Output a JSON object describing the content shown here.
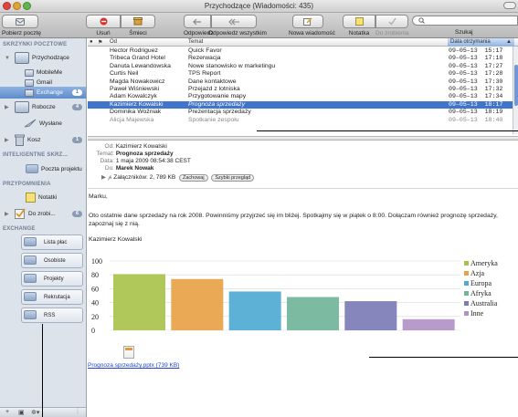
{
  "window": {
    "title": "Przychodzące (Wiadomości: 435)"
  },
  "toolbar": {
    "get_mail": "Pobierz pocztę",
    "delete": "Usuń",
    "junk": "Śmieci",
    "reply": "Odpowiedz",
    "reply_all": "Odpowiedz wszystkim",
    "new_message": "Nowa wiadomość",
    "note": "Notatka",
    "todo": "Do zrobienia",
    "search": "Szukaj"
  },
  "sidebar": {
    "mailboxes_header": "SKRZYNKI POCZTOWE",
    "inbox": "Przychodzące",
    "mobileme": "MobileMe",
    "gmail": "Gmail",
    "exchange": "Exchange",
    "exchange_count": "1",
    "drafts": "Robocze",
    "drafts_count": "4",
    "sent": "Wysłane",
    "trash": "Kosz",
    "trash_count": "1",
    "smart_header": "INTELIGENTNE SKRZ...",
    "project_mail": "Poczta projektu",
    "reminders_header": "PRZYPOMNIENIA",
    "notes": "Notatki",
    "todos": "Do zrobi...",
    "todos_count": "6",
    "exchange_header": "EXCHANGE",
    "folders": [
      "Lista płac",
      "Osobiste",
      "Projekty",
      "Rekrutacja",
      "RSS"
    ]
  },
  "message_list": {
    "col_from": "Od",
    "col_subject": "Temat",
    "col_date": "Data otrzymania",
    "rows": [
      {
        "from": "Hector Rodriguez",
        "subject": "Quick Favor",
        "date": "09–05–13",
        "time": "15:17"
      },
      {
        "from": "Tribeca Grand Hotel",
        "subject": "Rezerwacja",
        "date": "09–05–13",
        "time": "17:18"
      },
      {
        "from": "Danuta Lewandowska",
        "subject": "Nowe stanowisko w marketingu",
        "date": "09–05–13",
        "time": "17:27"
      },
      {
        "from": "Curtis Neil",
        "subject": "TPS Report",
        "date": "09–05–13",
        "time": "17:28"
      },
      {
        "from": "Magda Nowakowicz",
        "subject": "Dane kontaktowe",
        "date": "09–05–13",
        "time": "17:30"
      },
      {
        "from": "Paweł Wiśniewski",
        "subject": "Przejazd z lotniska",
        "date": "09–05–13",
        "time": "17:32"
      },
      {
        "from": "Adam Kowalczyk",
        "subject": "Przygotowanie mapy",
        "date": "09–05–13",
        "time": "17:34"
      },
      {
        "from": "Kazimierz Kowalski",
        "subject": "Prognoza sprzedaży",
        "date": "09–05–13",
        "time": "18:17"
      },
      {
        "from": "Dominika Woźniak",
        "subject": "Prezentacja sprzedaży",
        "date": "09–05–13",
        "time": "18:19"
      },
      {
        "from": "Alicja Majewska",
        "subject": "Spotkanie zespołu",
        "date": "09–05–13",
        "time": "18:40"
      }
    ]
  },
  "message": {
    "from_label": "Od:",
    "from": "Kazimierz Kowalski",
    "subject_label": "Temat:",
    "subject": "Prognoza sprzedaży",
    "date_label": "Data:",
    "date": "1 maja 2009 08:54:38 CEST",
    "to_label": "Do:",
    "to": "Marek Nowak",
    "attachments": "Załączników: 2, 789 KB",
    "save_btn": "Zachowaj",
    "quicklook_btn": "Szybki przegląd",
    "greeting": "Marku,",
    "para1": "Oto ostatnie dane sprzedaży na rok 2008. Powinniśmy przyjrzeć się im bliżej. Spotkajmy się w piątek o 8:00. Dołączam również prognozę sprzedaży,",
    "para2": "zapoznaj się z nią.",
    "signature": "Kazimierz Kowalski",
    "attachment_name": "Prognoza sprzedaży.pptx (739 KB)"
  },
  "chart_data": {
    "type": "bar",
    "categories": [
      "Ameryka",
      "Azja",
      "Europa",
      "Afryka",
      "Australia",
      "Inne"
    ],
    "values": [
      81,
      74,
      56,
      48,
      42,
      16
    ],
    "ylim": [
      0,
      100
    ],
    "yticks": [
      "0",
      "20",
      "40",
      "60",
      "80",
      "100"
    ],
    "legend_position": "right",
    "colors": [
      "#a9c24c",
      "#e7a246",
      "#4fa9d2",
      "#72b49a",
      "#7c7bb6",
      "#b292c6"
    ],
    "grid": true
  }
}
